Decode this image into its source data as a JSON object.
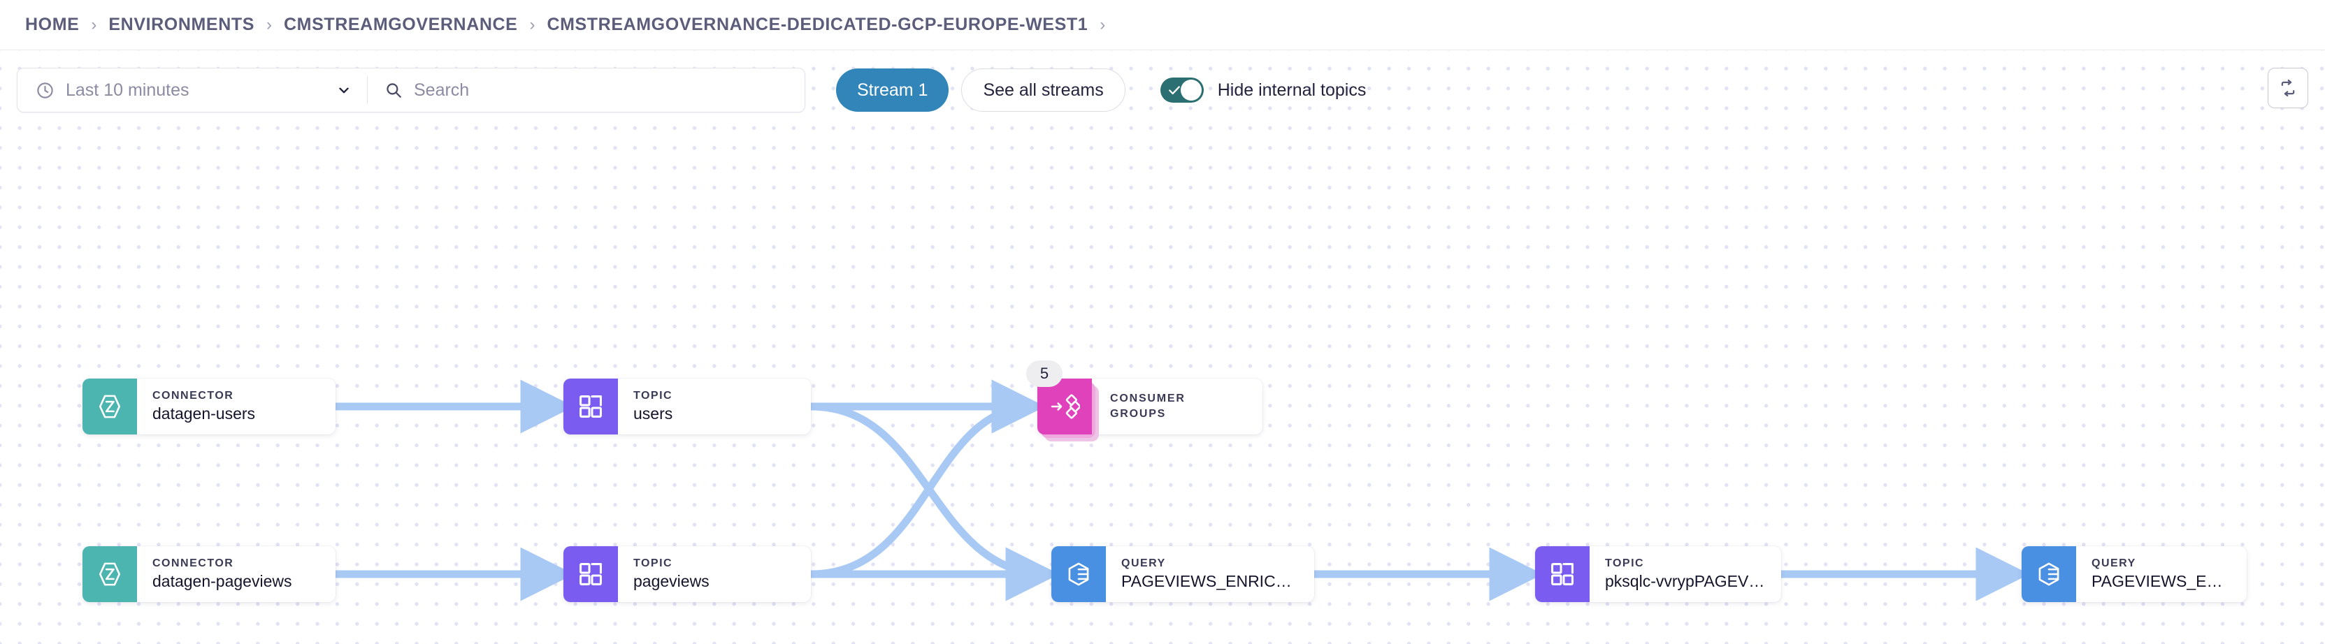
{
  "breadcrumb": {
    "separator": "›",
    "items": [
      {
        "label": "HOME"
      },
      {
        "label": "ENVIRONMENTS"
      },
      {
        "label": "CMSTREAMGOVERNANCE"
      },
      {
        "label": "CMSTREAMGOVERNANCE-DEDICATED-GCP-EUROPE-WEST1"
      }
    ]
  },
  "toolbar": {
    "time_range": {
      "icon": "clock-icon",
      "value": "Last 10 minutes",
      "chevron": "chevron-down-icon"
    },
    "search": {
      "icon": "search-icon",
      "value": "",
      "placeholder": "Search"
    },
    "stream_button": "Stream 1",
    "see_all_streams_button": "See all streams",
    "hide_internal_topics": {
      "label": "Hide internal topics",
      "checked": true,
      "icon": "check-icon"
    },
    "refresh_button": {
      "icon": "refresh-icon",
      "label": ""
    }
  },
  "colors": {
    "connector": "#4cb5b0",
    "topic": "#7b5cf0",
    "query": "#4a90e2",
    "consumer_group": "#e042bb",
    "edge": "#a9c9f5",
    "accent_blue": "#3185b8",
    "toggle_on": "#2c6f72",
    "breadcrumb_text": "#5c5c7b",
    "dot_grid": "#e2e2f5"
  },
  "graph": {
    "nodes": [
      {
        "id": "connector-users",
        "kind": "CONNECTOR",
        "title": "datagen-users",
        "icon": "connector-icon",
        "color": "#4cb5b0"
      },
      {
        "id": "topic-users",
        "kind": "TOPIC",
        "title": "users",
        "icon": "topic-grid-icon",
        "color": "#7b5cf0"
      },
      {
        "id": "consumer-groups",
        "kind": "CONSUMER GROUPS",
        "title": "",
        "icon": "consumer-groups-icon",
        "color": "#e042bb",
        "badge": "5"
      },
      {
        "id": "connector-pageviews",
        "kind": "CONNECTOR",
        "title": "datagen-pageviews",
        "icon": "connector-icon",
        "color": "#4cb5b0"
      },
      {
        "id": "topic-pageviews",
        "kind": "TOPIC",
        "title": "pageviews",
        "icon": "topic-grid-icon",
        "color": "#7b5cf0"
      },
      {
        "id": "query-enriched",
        "kind": "QUERY",
        "title": "PAGEVIEWS_ENRICHED",
        "icon": "query-icon",
        "color": "#4a90e2"
      },
      {
        "id": "topic-pksqlc",
        "kind": "TOPIC",
        "title": "pksqlc-vvrypPAGEVIE…",
        "icon": "topic-grid-icon",
        "color": "#7b5cf0"
      },
      {
        "id": "query-enri",
        "kind": "QUERY",
        "title": "PAGEVIEWS_ENRI…",
        "icon": "query-icon",
        "color": "#4a90e2"
      }
    ]
  }
}
